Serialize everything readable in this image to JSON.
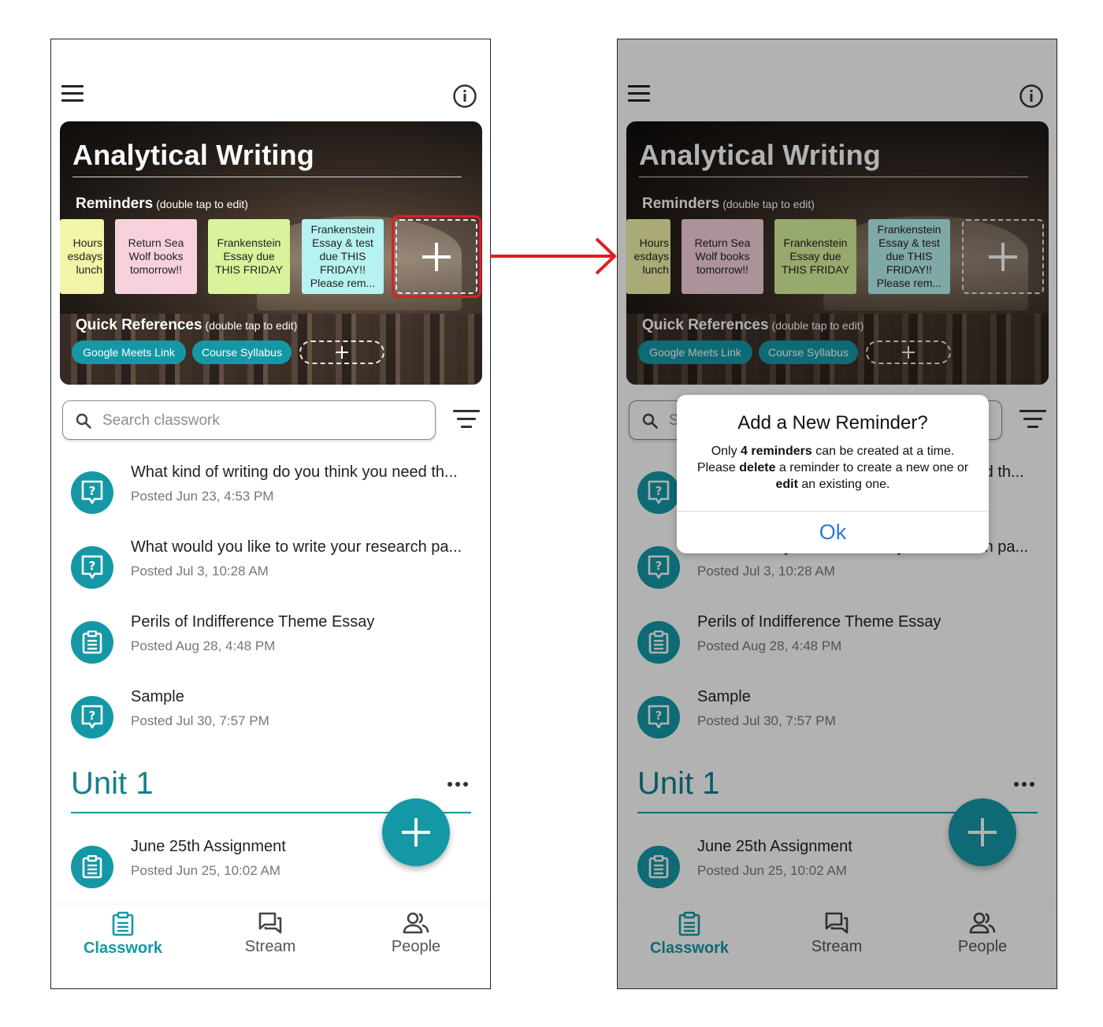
{
  "course": {
    "title": "Analytical Writing",
    "reminders_label": "Reminders",
    "reminders_hint": "(double tap to edit)",
    "reminders": [
      {
        "text": "Hours esdays lunch",
        "color": "#f2f4a8"
      },
      {
        "text": "Return Sea Wolf books tomorrow!!",
        "color": "#f7d2dc"
      },
      {
        "text": "Frankenstein Essay due THIS FRIDAY",
        "color": "#d9f29b"
      },
      {
        "text": "Frankenstein Essay & test due THIS FRIDAY!! Please rem...",
        "color": "#b6f2f0"
      }
    ],
    "quick_refs_label": "Quick References",
    "quick_refs_hint": "(double tap to edit)",
    "quick_refs": [
      "Google Meets Link",
      "Course Syllabus"
    ]
  },
  "search": {
    "placeholder": "Search classwork"
  },
  "posts": [
    {
      "icon": "question-icon",
      "title": "What kind of writing do you think you need th...",
      "date": "Posted Jun 23, 4:53 PM"
    },
    {
      "icon": "question-icon",
      "title": "What would you like to write your research pa...",
      "date": "Posted Jul 3, 10:28 AM"
    },
    {
      "icon": "assignment-icon",
      "title": "Perils of Indifference Theme Essay",
      "date": "Posted Aug 28, 4:48 PM"
    },
    {
      "icon": "question-icon",
      "title": "Sample",
      "date": "Posted Jul 30, 7:57 PM"
    }
  ],
  "unit": {
    "title": "Unit 1",
    "posts": [
      {
        "icon": "assignment-icon",
        "title": "June 25th Assignment",
        "date": "Posted Jun 25, 10:02 AM"
      }
    ]
  },
  "nav": {
    "classwork": "Classwork",
    "stream": "Stream",
    "people": "People"
  },
  "dialog": {
    "title": "Add a New Reminder?",
    "line1_pre": "Only ",
    "line1_bold": "4 reminders",
    "line1_post": " can be created at a time.",
    "line2_pre": "Please ",
    "line2_bold1": "delete",
    "line2_mid": " a reminder to create a new one or",
    "line3_bold2": "edit",
    "line3_post": " an existing one.",
    "ok": "Ok"
  },
  "colors": {
    "accent": "#1598a6",
    "unit_title": "#12808c",
    "highlight": "#e31c23",
    "dialog_button": "#2b7cd3"
  }
}
